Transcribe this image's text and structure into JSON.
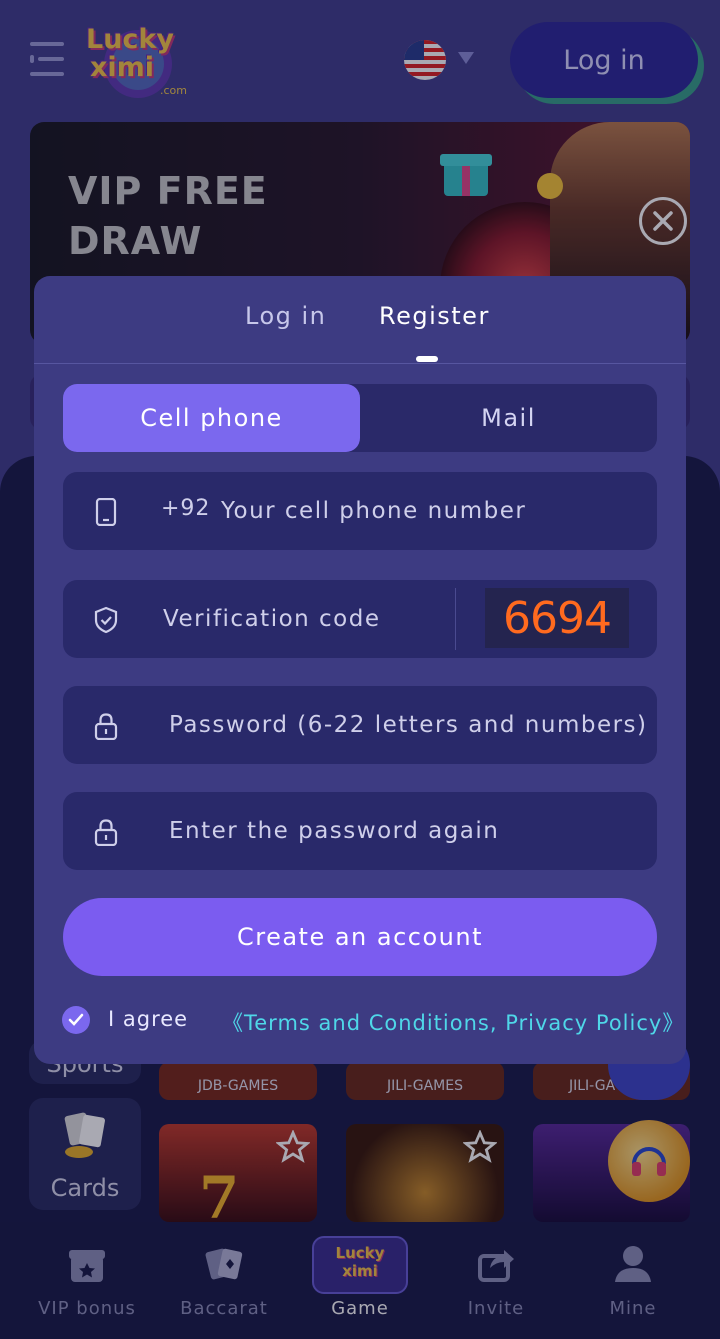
{
  "header": {
    "logo_text_line1": "Lucky",
    "logo_text_line2": "ximi",
    "logo_suffix": ".com",
    "login_button": "Log in",
    "language_icon": "us-flag-icon"
  },
  "banner": {
    "title_line1": "VIP FREE",
    "title_line2": "DRAW"
  },
  "side_categories": [
    {
      "label": "Sports"
    },
    {
      "label": "Cards"
    }
  ],
  "game_tiles": [
    {
      "label": "JDB-GAMES"
    },
    {
      "label": "JILI-GAMES"
    },
    {
      "label": "JILI-GA"
    }
  ],
  "modal": {
    "tabs": [
      {
        "label": "Log in",
        "active": false
      },
      {
        "label": "Register",
        "active": true
      }
    ],
    "segments": [
      {
        "label": "Cell phone",
        "active": true
      },
      {
        "label": "Mail",
        "active": false
      }
    ],
    "phone": {
      "prefix": "+92",
      "placeholder": "Your cell phone number",
      "icon": "phone-icon"
    },
    "verification": {
      "placeholder": "Verification code",
      "captcha": "6694",
      "icon": "shield-check-icon"
    },
    "password": {
      "placeholder": "Password (6-22 letters and numbers)",
      "icon": "lock-icon"
    },
    "password_confirm": {
      "placeholder": "Enter the password again",
      "icon": "lock-icon"
    },
    "create_button": "Create an account",
    "agree_checked": true,
    "agree_label": "I agree",
    "terms_link": "《Terms and Conditions, Privacy Policy》"
  },
  "bottom_nav": [
    {
      "label": "VIP bonus",
      "icon": "gift-icon",
      "active": false
    },
    {
      "label": "Baccarat",
      "icon": "cards-icon",
      "active": false
    },
    {
      "label": "Game",
      "icon": "luckyximi-logo-icon",
      "active": true
    },
    {
      "label": "Invite",
      "icon": "share-icon",
      "active": false
    },
    {
      "label": "Mine",
      "icon": "user-icon",
      "active": false
    }
  ],
  "colors": {
    "accent": "#7b68ee",
    "modal_bg": "#3d3b82",
    "field_bg": "#29296a",
    "captcha": "#ff6a1f",
    "link": "#4fd7e8"
  }
}
